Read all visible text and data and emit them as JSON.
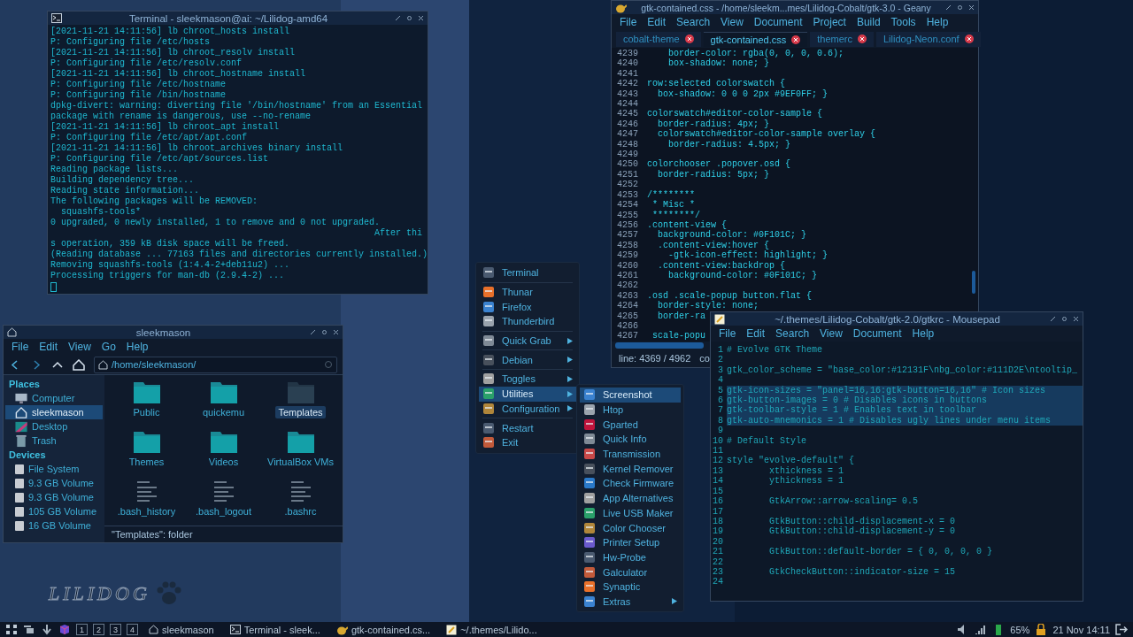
{
  "terminal": {
    "title": "Terminal - sleekmason@ai: ~/Lilidog-amd64",
    "lines": [
      "[2021-11-21 14:11:56] lb chroot_hosts install",
      "P: Configuring file /etc/hosts",
      "[2021-11-21 14:11:56] lb chroot_resolv install",
      "P: Configuring file /etc/resolv.conf",
      "[2021-11-21 14:11:56] lb chroot_hostname install",
      "P: Configuring file /etc/hostname",
      "P: Configuring file /bin/hostname",
      "dpkg-divert: warning: diverting file '/bin/hostname' from an Essential",
      "package with rename is dangerous, use --no-rename",
      "[2021-11-21 14:11:56] lb chroot_apt install",
      "P: Configuring file /etc/apt/apt.conf",
      "[2021-11-21 14:11:56] lb chroot_archives binary install",
      "P: Configuring file /etc/apt/sources.list",
      "Reading package lists...",
      "Building dependency tree...",
      "Reading state information...",
      "The following packages will be REMOVED:",
      "  squashfs-tools*",
      "0 upgraded, 0 newly installed, 1 to remove and 0 not upgraded.",
      "                                                             After thi",
      "s operation, 359 kB disk space will be freed.",
      "(Reading database ... 77163 files and directories currently installed.)",
      "Removing squashfs-tools (1:4.4-2+deb11u2) ...",
      "Processing triggers for man-db (2.9.4-2) ..."
    ]
  },
  "file_manager": {
    "title": "sleekmason",
    "menu": [
      "File",
      "Edit",
      "View",
      "Go",
      "Help"
    ],
    "path": "/home/sleekmason/",
    "sidebar": [
      {
        "heading": "Places",
        "items": [
          {
            "label": "Computer",
            "selected": false
          },
          {
            "label": "sleekmason",
            "selected": true
          },
          {
            "label": "Desktop",
            "selected": false
          },
          {
            "label": "Trash",
            "selected": false
          }
        ]
      },
      {
        "heading": "Devices",
        "items": [
          {
            "label": "File System",
            "selected": false
          },
          {
            "label": "9.3 GB Volume",
            "selected": false
          },
          {
            "label": "9.3 GB Volume",
            "selected": false
          },
          {
            "label": "105 GB Volume",
            "selected": false
          },
          {
            "label": "16 GB Volume",
            "selected": false
          }
        ]
      }
    ],
    "files": [
      {
        "name": "Public",
        "kind": "folder",
        "selected": false
      },
      {
        "name": "quickemu",
        "kind": "folder",
        "selected": false
      },
      {
        "name": "Templates",
        "kind": "folder",
        "selected": true
      },
      {
        "name": "Themes",
        "kind": "folder",
        "selected": false
      },
      {
        "name": "Videos",
        "kind": "folder",
        "selected": false
      },
      {
        "name": "VirtualBox VMs",
        "kind": "folder",
        "selected": false
      },
      {
        "name": ".bash_history",
        "kind": "file",
        "selected": false
      },
      {
        "name": ".bash_logout",
        "kind": "file",
        "selected": false
      },
      {
        "name": ".bashrc",
        "kind": "file",
        "selected": false
      }
    ],
    "status": "\"Templates\": folder"
  },
  "menu": {
    "items": [
      {
        "kind": "item",
        "label": "Terminal",
        "submenu": false,
        "selected": false
      },
      {
        "kind": "separator"
      },
      {
        "kind": "item",
        "label": "Thunar",
        "submenu": false,
        "selected": false
      },
      {
        "kind": "item",
        "label": "Firefox",
        "submenu": false,
        "selected": false
      },
      {
        "kind": "item",
        "label": "Thunderbird",
        "submenu": false,
        "selected": false
      },
      {
        "kind": "separator"
      },
      {
        "kind": "item",
        "label": "Quick Grab",
        "submenu": true,
        "selected": false
      },
      {
        "kind": "separator"
      },
      {
        "kind": "item",
        "label": "Debian",
        "submenu": true,
        "selected": false
      },
      {
        "kind": "separator"
      },
      {
        "kind": "item",
        "label": "Toggles",
        "submenu": true,
        "selected": false
      },
      {
        "kind": "item",
        "label": "Utilities",
        "submenu": true,
        "selected": true
      },
      {
        "kind": "item",
        "label": "Configuration",
        "submenu": true,
        "selected": false
      },
      {
        "kind": "separator"
      },
      {
        "kind": "item",
        "label": "Restart",
        "submenu": false,
        "selected": false
      },
      {
        "kind": "item",
        "label": "Exit",
        "submenu": false,
        "selected": false
      }
    ]
  },
  "submenu": {
    "items": [
      {
        "kind": "item",
        "label": "Screenshot",
        "submenu": false,
        "selected": true
      },
      {
        "kind": "item",
        "label": "Htop",
        "submenu": false,
        "selected": false
      },
      {
        "kind": "item",
        "label": "Gparted",
        "submenu": false,
        "selected": false
      },
      {
        "kind": "item",
        "label": "Quick Info",
        "submenu": false,
        "selected": false
      },
      {
        "kind": "item",
        "label": "Transmission",
        "submenu": false,
        "selected": false
      },
      {
        "kind": "item",
        "label": "Kernel Remover",
        "submenu": false,
        "selected": false
      },
      {
        "kind": "item",
        "label": "Check Firmware",
        "submenu": false,
        "selected": false
      },
      {
        "kind": "item",
        "label": "App Alternatives",
        "submenu": false,
        "selected": false
      },
      {
        "kind": "item",
        "label": "Live USB Maker",
        "submenu": false,
        "selected": false
      },
      {
        "kind": "item",
        "label": "Color Chooser",
        "submenu": false,
        "selected": false
      },
      {
        "kind": "item",
        "label": "Printer Setup",
        "submenu": false,
        "selected": false
      },
      {
        "kind": "item",
        "label": "Hw-Probe",
        "submenu": false,
        "selected": false
      },
      {
        "kind": "item",
        "label": "Galculator",
        "submenu": false,
        "selected": false
      },
      {
        "kind": "item",
        "label": "Synaptic",
        "submenu": false,
        "selected": false
      },
      {
        "kind": "item",
        "label": "Extras",
        "submenu": true,
        "selected": false
      }
    ]
  },
  "geany": {
    "title": "gtk-contained.css - /home/sleekm...mes/Lilidog-Cobalt/gtk-3.0 - Geany",
    "menu": [
      "File",
      "Edit",
      "Search",
      "View",
      "Document",
      "Project",
      "Build",
      "Tools",
      "Help"
    ],
    "tabs": [
      {
        "label": "cobalt-theme",
        "selected": false
      },
      {
        "label": "gtk-contained.css",
        "selected": true
      },
      {
        "label": "themerc",
        "selected": false
      },
      {
        "label": "Lilidog-Neon.conf",
        "selected": false
      }
    ],
    "lines": [
      {
        "number": "4239",
        "text": "    border-color: rgba(0, 0, 0, 0.6);"
      },
      {
        "number": "4240",
        "text": "    box-shadow: none; }"
      },
      {
        "number": "4241"
      },
      {
        "number": "4242",
        "text": "row:selected colorswatch {"
      },
      {
        "number": "4243",
        "text": "  box-shadow: 0 0 0 2px #9EF0FF; }"
      },
      {
        "number": "4244"
      },
      {
        "number": "4245",
        "text": "colorswatch#editor-color-sample {"
      },
      {
        "number": "4246",
        "text": "  border-radius: 4px; }"
      },
      {
        "number": "4247",
        "text": "  colorswatch#editor-color-sample overlay {"
      },
      {
        "number": "4248",
        "text": "    border-radius: 4.5px; }"
      },
      {
        "number": "4249"
      },
      {
        "number": "4250",
        "text": "colorchooser .popover.osd {"
      },
      {
        "number": "4251",
        "text": "  border-radius: 5px; }"
      },
      {
        "number": "4252"
      },
      {
        "number": "4253",
        "text": "/********"
      },
      {
        "number": "4254",
        "text": " * Misc *"
      },
      {
        "number": "4255",
        "text": " ********/"
      },
      {
        "number": "4256",
        "text": ".content-view {"
      },
      {
        "number": "4257",
        "text": "  background-color: #0F101C; }"
      },
      {
        "number": "4258",
        "text": "  .content-view:hover {"
      },
      {
        "number": "4259",
        "text": "    -gtk-icon-effect: highlight; }"
      },
      {
        "number": "4260",
        "text": "  .content-view:backdrop {"
      },
      {
        "number": "4261",
        "text": "    background-color: #0F101C; }"
      },
      {
        "number": "4262"
      },
      {
        "number": "4263",
        "text": ".osd .scale-popup button.flat {"
      },
      {
        "number": "4264",
        "text": "  border-style: none;"
      },
      {
        "number": "4265",
        "text": "  border-ra"
      },
      {
        "number": "4266"
      },
      {
        "number": "4267",
        "text": " scale-popu"
      }
    ],
    "status": [
      "line: 4369 / 4962",
      "co"
    ]
  },
  "mousepad": {
    "title": "~/.themes/Lilidog-Cobalt/gtk-2.0/gtkrc - Mousepad",
    "menu": [
      "File",
      "Edit",
      "Search",
      "View",
      "Document",
      "Help"
    ],
    "lines": [
      {
        "number": "1",
        "text": "# Evolve GTK Theme",
        "selected": false
      },
      {
        "number": "2",
        "selected": false
      },
      {
        "number": "3",
        "text": "gtk_color_scheme = \"base_color:#12131F\\nbg_color:#111D2E\\ntooltip_",
        "selected": false
      },
      {
        "number": "4",
        "selected": false
      },
      {
        "number": "5",
        "text": "gtk-icon-sizes = \"panel=16,16:gtk-button=16,16\" # Icon sizes",
        "selected": true
      },
      {
        "number": "6",
        "text": "gtk-button-images = 0 # Disables icons in buttons",
        "selected": true
      },
      {
        "number": "7",
        "text": "gtk-toolbar-style = 1 # Enables text in toolbar",
        "selected": true
      },
      {
        "number": "8",
        "text": "gtk-auto-mnemonics = 1 # Disables ugly lines under menu items",
        "selected": true
      },
      {
        "number": "9",
        "selected": false
      },
      {
        "number": "10",
        "text": "# Default Style",
        "selected": false
      },
      {
        "number": "11",
        "selected": false
      },
      {
        "number": "12",
        "text": "style \"evolve-default\" {",
        "selected": false
      },
      {
        "number": "13",
        "text": "        xthickness = 1",
        "selected": false
      },
      {
        "number": "14",
        "text": "        ythickness = 1",
        "selected": false
      },
      {
        "number": "15",
        "selected": false
      },
      {
        "number": "16",
        "text": "        GtkArrow::arrow-scaling= 0.5",
        "selected": false
      },
      {
        "number": "17",
        "selected": false
      },
      {
        "number": "18",
        "text": "        GtkButton::child-displacement-x = 0",
        "selected": false
      },
      {
        "number": "19",
        "text": "        GtkButton::child-displacement-y = 0",
        "selected": false
      },
      {
        "number": "20",
        "selected": false
      },
      {
        "number": "21",
        "text": "        GtkButton::default-border = { 0, 0, 0, 0 }",
        "selected": false
      },
      {
        "number": "22",
        "selected": false
      },
      {
        "number": "23",
        "text": "        GtkCheckButton::indicator-size = 15",
        "selected": false
      },
      {
        "number": "24",
        "selected": false
      }
    ]
  },
  "logo": "LILIDOG",
  "taskbar": {
    "workspaces": [
      "1",
      "2",
      "3",
      "4"
    ],
    "tasks": [
      "sleekmason",
      "Terminal - sleek...",
      "gtk-contained.cs...",
      "~/.themes/Lilido..."
    ],
    "battery": "65%",
    "clock": "21 Nov 14:11"
  }
}
